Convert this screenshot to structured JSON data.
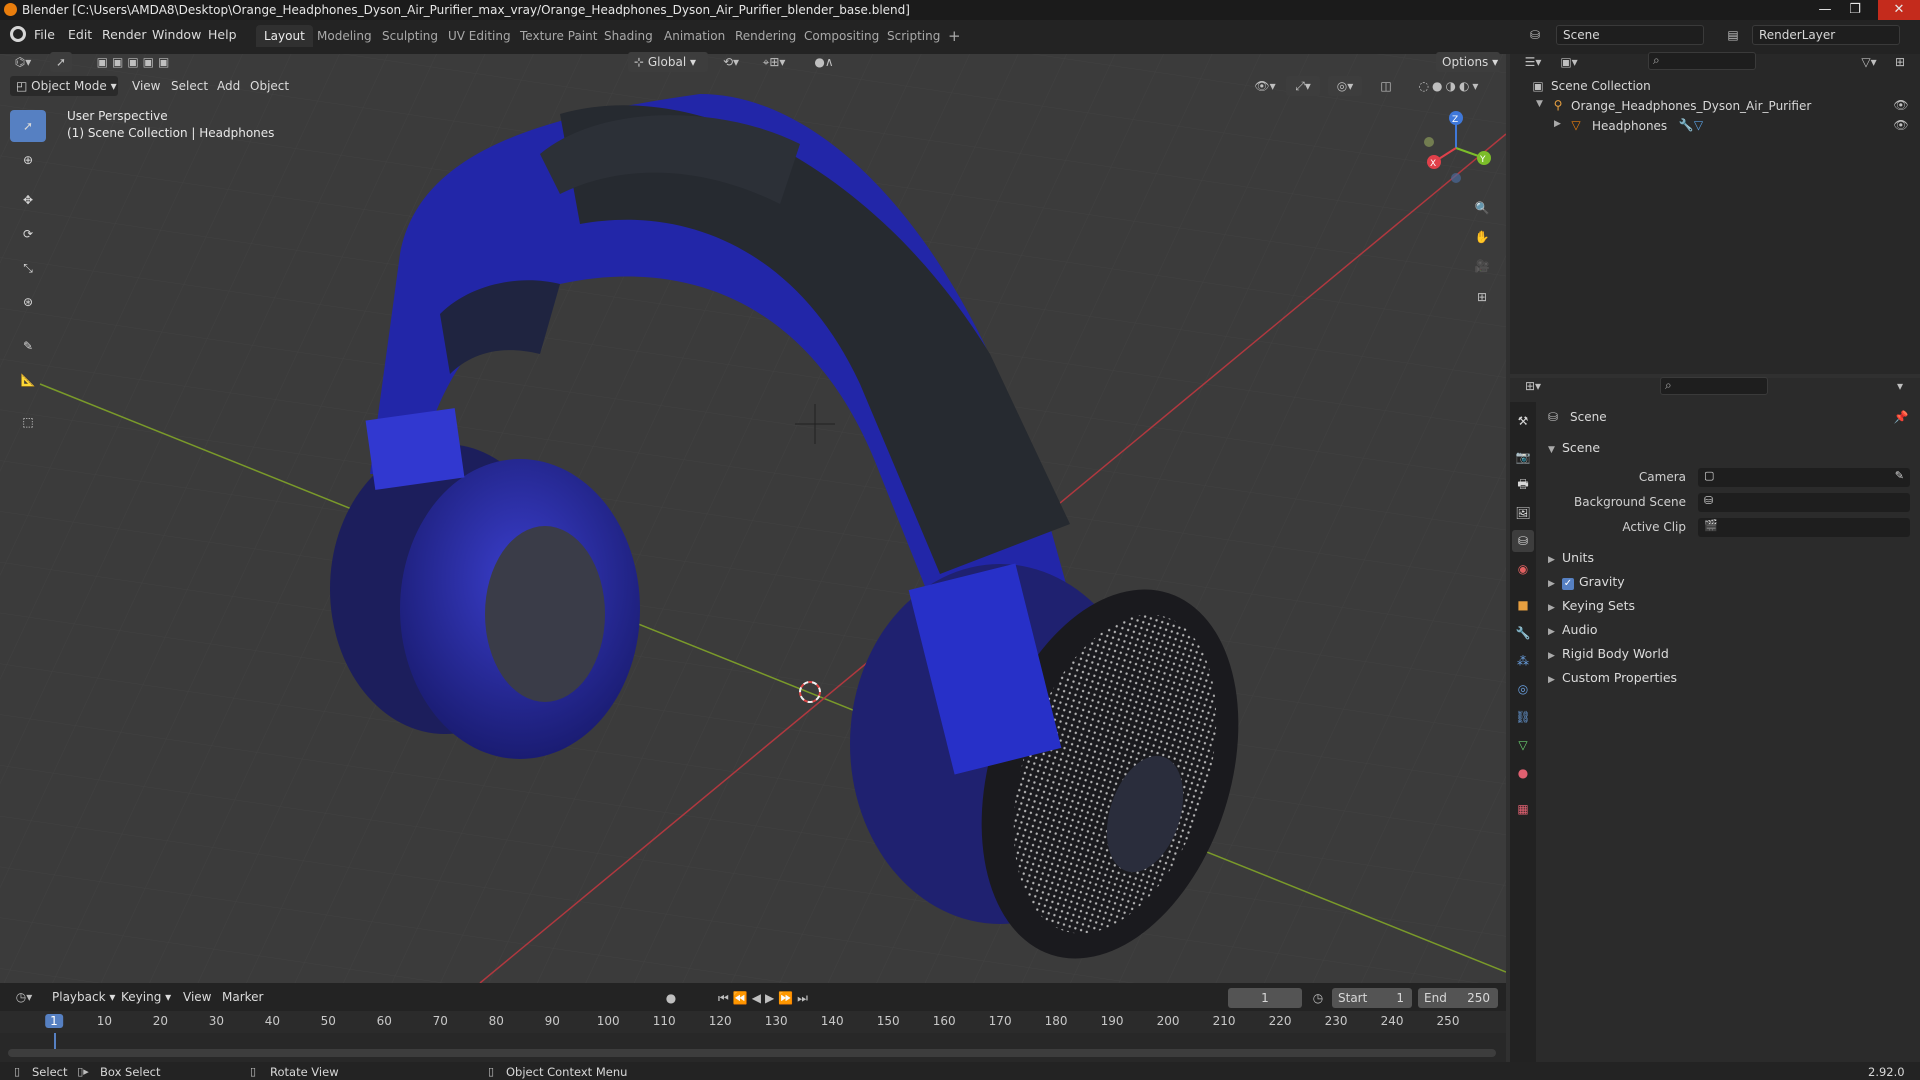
{
  "titlebar": {
    "title": "Blender [C:\\Users\\AMDA8\\Desktop\\Orange_Headphones_Dyson_Air_Purifier_max_vray/Orange_Headphones_Dyson_Air_Purifier_blender_base.blend]",
    "minimize": "—",
    "maximize": "❐",
    "close": "✕"
  },
  "menu": {
    "items": [
      "File",
      "Edit",
      "Render",
      "Window",
      "Help"
    ]
  },
  "workspaces": {
    "tabs": [
      "Layout",
      "Modeling",
      "Sculpting",
      "UV Editing",
      "Texture Paint",
      "Shading",
      "Animation",
      "Rendering",
      "Compositing",
      "Scripting"
    ],
    "add": "+"
  },
  "scene_selector": {
    "value": "Scene"
  },
  "renderlayer_selector": {
    "value": "RenderLayer"
  },
  "viewport_header": {
    "transform_orientation": "Global",
    "options": "Options",
    "mode": "Object Mode",
    "menus": [
      "View",
      "Select",
      "Add",
      "Object"
    ]
  },
  "viewport_overlay": {
    "perspective": "User Perspective",
    "collection": "(1) Scene Collection | Headphones"
  },
  "gizmo": {
    "x": "X",
    "y": "Y",
    "z": "Z"
  },
  "outliner": {
    "root": "Scene Collection",
    "items": [
      {
        "label": "Orange_Headphones_Dyson_Air_Purifier"
      },
      {
        "label": "Headphones"
      }
    ]
  },
  "properties": {
    "context_title": "Scene",
    "section": "Scene",
    "fields": [
      {
        "label": "Camera"
      },
      {
        "label": "Background Scene"
      },
      {
        "label": "Active Clip"
      }
    ],
    "panels": [
      "Units",
      "Gravity",
      "Keying Sets",
      "Audio",
      "Rigid Body World",
      "Custom Properties"
    ],
    "gravity_checked": true
  },
  "timeline": {
    "menus": [
      "Playback",
      "Keying",
      "View",
      "Marker"
    ],
    "current_frame": "1",
    "start_label": "Start",
    "start": "1",
    "end_label": "End",
    "end": "250",
    "ticks": [
      "1",
      "10",
      "20",
      "30",
      "40",
      "50",
      "60",
      "70",
      "80",
      "90",
      "100",
      "110",
      "120",
      "130",
      "140",
      "150",
      "160",
      "170",
      "180",
      "190",
      "200",
      "210",
      "220",
      "230",
      "240",
      "250"
    ]
  },
  "statusbar": {
    "select": "Select",
    "box_select": "Box Select",
    "rotate": "Rotate View",
    "context_menu": "Object Context Menu",
    "version": "2.92.0"
  },
  "colors": {
    "accent": "#5680c2",
    "axis_x": "#e0404a",
    "axis_y": "#7cbd2a",
    "axis_z": "#3f78d9",
    "headphone_blue": "#2a2fb0"
  }
}
